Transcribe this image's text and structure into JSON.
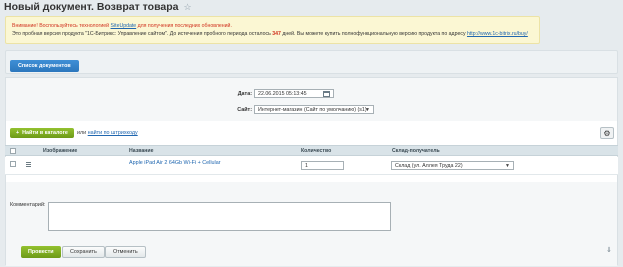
{
  "page": {
    "title": "Новый документ. Возврат товара",
    "star_icon": "☆"
  },
  "notice": {
    "line1_warning": "Внимание! Воспользуйтесь технологией ",
    "line1_link": "SiteUpdate",
    "line1_rest": " для получения последних обновлений.",
    "line2_start": "Это пробная версия продукта \"1С-Битрикс: Управление сайтом\". До истечения пробного периода осталось ",
    "days_left": "347",
    "line2_mid": " дней. Вы можете купить полнофункциональную версию продукта по адресу ",
    "line2_link": "http://www.1c-bitrix.ru/buy/"
  },
  "tabs": {
    "documents_list": "Список документов"
  },
  "form": {
    "date_label": "Дата:",
    "date_value": "22.06.2015 05:13:45",
    "site_label": "Сайт:",
    "site_value": "Интернет-магазин (Сайт по умолчанию) (s1)"
  },
  "toolbar": {
    "find_in_catalog": "Найти в каталоге",
    "find_plus": "+",
    "or_text": "или ",
    "find_by_barcode": "найти по штрихкоду",
    "gear_icon": "⚙"
  },
  "table": {
    "headers": [
      "Изображение",
      "Название",
      "Количество",
      "Склад-получатель"
    ],
    "rows": [
      {
        "name": "Apple iPad Air 2 64Gb Wi-Fi + Cellular",
        "quantity": "1",
        "warehouse": "Склад (ул. Аллея Труда 22)"
      }
    ]
  },
  "comment": {
    "label": "Комментарий:",
    "value": ""
  },
  "buttons": {
    "submit": "Провести",
    "save": "Сохранить",
    "cancel": "Отменить"
  },
  "colors": {
    "accent_blue": "#2c77bd",
    "accent_green": "#6d9a17",
    "warning_red": "#d0311e"
  }
}
